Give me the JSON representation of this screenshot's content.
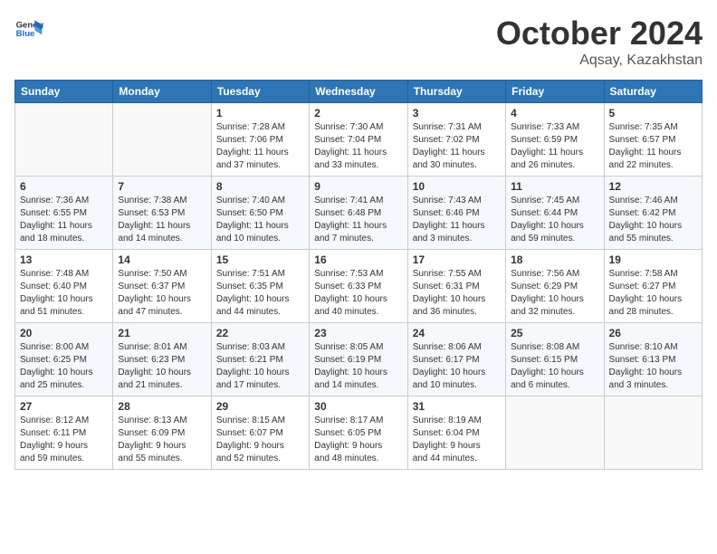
{
  "header": {
    "logo_general": "General",
    "logo_blue": "Blue",
    "month_title": "October 2024",
    "location": "Aqsay, Kazakhstan"
  },
  "weekdays": [
    "Sunday",
    "Monday",
    "Tuesday",
    "Wednesday",
    "Thursday",
    "Friday",
    "Saturday"
  ],
  "weeks": [
    [
      {
        "day": "",
        "info": ""
      },
      {
        "day": "",
        "info": ""
      },
      {
        "day": "1",
        "info": "Sunrise: 7:28 AM\nSunset: 7:06 PM\nDaylight: 11 hours\nand 37 minutes."
      },
      {
        "day": "2",
        "info": "Sunrise: 7:30 AM\nSunset: 7:04 PM\nDaylight: 11 hours\nand 33 minutes."
      },
      {
        "day": "3",
        "info": "Sunrise: 7:31 AM\nSunset: 7:02 PM\nDaylight: 11 hours\nand 30 minutes."
      },
      {
        "day": "4",
        "info": "Sunrise: 7:33 AM\nSunset: 6:59 PM\nDaylight: 11 hours\nand 26 minutes."
      },
      {
        "day": "5",
        "info": "Sunrise: 7:35 AM\nSunset: 6:57 PM\nDaylight: 11 hours\nand 22 minutes."
      }
    ],
    [
      {
        "day": "6",
        "info": "Sunrise: 7:36 AM\nSunset: 6:55 PM\nDaylight: 11 hours\nand 18 minutes."
      },
      {
        "day": "7",
        "info": "Sunrise: 7:38 AM\nSunset: 6:53 PM\nDaylight: 11 hours\nand 14 minutes."
      },
      {
        "day": "8",
        "info": "Sunrise: 7:40 AM\nSunset: 6:50 PM\nDaylight: 11 hours\nand 10 minutes."
      },
      {
        "day": "9",
        "info": "Sunrise: 7:41 AM\nSunset: 6:48 PM\nDaylight: 11 hours\nand 7 minutes."
      },
      {
        "day": "10",
        "info": "Sunrise: 7:43 AM\nSunset: 6:46 PM\nDaylight: 11 hours\nand 3 minutes."
      },
      {
        "day": "11",
        "info": "Sunrise: 7:45 AM\nSunset: 6:44 PM\nDaylight: 10 hours\nand 59 minutes."
      },
      {
        "day": "12",
        "info": "Sunrise: 7:46 AM\nSunset: 6:42 PM\nDaylight: 10 hours\nand 55 minutes."
      }
    ],
    [
      {
        "day": "13",
        "info": "Sunrise: 7:48 AM\nSunset: 6:40 PM\nDaylight: 10 hours\nand 51 minutes."
      },
      {
        "day": "14",
        "info": "Sunrise: 7:50 AM\nSunset: 6:37 PM\nDaylight: 10 hours\nand 47 minutes."
      },
      {
        "day": "15",
        "info": "Sunrise: 7:51 AM\nSunset: 6:35 PM\nDaylight: 10 hours\nand 44 minutes."
      },
      {
        "day": "16",
        "info": "Sunrise: 7:53 AM\nSunset: 6:33 PM\nDaylight: 10 hours\nand 40 minutes."
      },
      {
        "day": "17",
        "info": "Sunrise: 7:55 AM\nSunset: 6:31 PM\nDaylight: 10 hours\nand 36 minutes."
      },
      {
        "day": "18",
        "info": "Sunrise: 7:56 AM\nSunset: 6:29 PM\nDaylight: 10 hours\nand 32 minutes."
      },
      {
        "day": "19",
        "info": "Sunrise: 7:58 AM\nSunset: 6:27 PM\nDaylight: 10 hours\nand 28 minutes."
      }
    ],
    [
      {
        "day": "20",
        "info": "Sunrise: 8:00 AM\nSunset: 6:25 PM\nDaylight: 10 hours\nand 25 minutes."
      },
      {
        "day": "21",
        "info": "Sunrise: 8:01 AM\nSunset: 6:23 PM\nDaylight: 10 hours\nand 21 minutes."
      },
      {
        "day": "22",
        "info": "Sunrise: 8:03 AM\nSunset: 6:21 PM\nDaylight: 10 hours\nand 17 minutes."
      },
      {
        "day": "23",
        "info": "Sunrise: 8:05 AM\nSunset: 6:19 PM\nDaylight: 10 hours\nand 14 minutes."
      },
      {
        "day": "24",
        "info": "Sunrise: 8:06 AM\nSunset: 6:17 PM\nDaylight: 10 hours\nand 10 minutes."
      },
      {
        "day": "25",
        "info": "Sunrise: 8:08 AM\nSunset: 6:15 PM\nDaylight: 10 hours\nand 6 minutes."
      },
      {
        "day": "26",
        "info": "Sunrise: 8:10 AM\nSunset: 6:13 PM\nDaylight: 10 hours\nand 3 minutes."
      }
    ],
    [
      {
        "day": "27",
        "info": "Sunrise: 8:12 AM\nSunset: 6:11 PM\nDaylight: 9 hours\nand 59 minutes."
      },
      {
        "day": "28",
        "info": "Sunrise: 8:13 AM\nSunset: 6:09 PM\nDaylight: 9 hours\nand 55 minutes."
      },
      {
        "day": "29",
        "info": "Sunrise: 8:15 AM\nSunset: 6:07 PM\nDaylight: 9 hours\nand 52 minutes."
      },
      {
        "day": "30",
        "info": "Sunrise: 8:17 AM\nSunset: 6:05 PM\nDaylight: 9 hours\nand 48 minutes."
      },
      {
        "day": "31",
        "info": "Sunrise: 8:19 AM\nSunset: 6:04 PM\nDaylight: 9 hours\nand 44 minutes."
      },
      {
        "day": "",
        "info": ""
      },
      {
        "day": "",
        "info": ""
      }
    ]
  ]
}
